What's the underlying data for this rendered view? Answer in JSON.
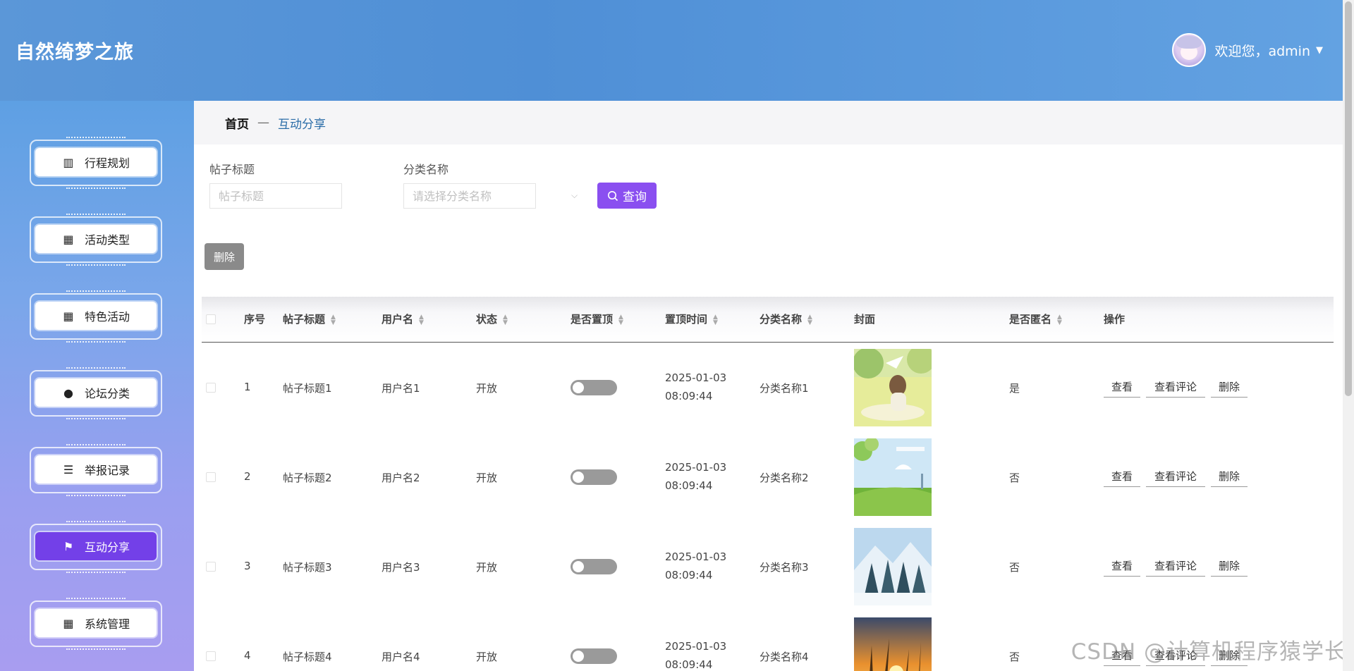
{
  "header": {
    "app_title": "自然绮梦之旅",
    "welcome_text": "欢迎您，admin",
    "caret": "▼"
  },
  "sidebar": {
    "items": [
      {
        "label": "行程规划",
        "icon": "bookshelf-icon",
        "glyph": "▥",
        "active": false
      },
      {
        "label": "活动类型",
        "icon": "grid-icon",
        "glyph": "▦",
        "active": false
      },
      {
        "label": "特色活动",
        "icon": "grid-icon",
        "glyph": "▦",
        "active": false
      },
      {
        "label": "论坛分类",
        "icon": "bulb-icon",
        "glyph": "●",
        "active": false
      },
      {
        "label": "举报记录",
        "icon": "sliders-icon",
        "glyph": "☰",
        "active": false
      },
      {
        "label": "互动分享",
        "icon": "flag-icon",
        "glyph": "⚑",
        "active": true
      },
      {
        "label": "系统管理",
        "icon": "grid-icon",
        "glyph": "▦",
        "active": false
      }
    ]
  },
  "breadcrumb": {
    "home": "首页",
    "separator": "—",
    "current": "互动分享"
  },
  "search": {
    "title_label": "帖子标题",
    "title_placeholder": "帖子标题",
    "category_label": "分类名称",
    "category_placeholder": "请选择分类名称",
    "search_button": "查询"
  },
  "toolbar": {
    "delete_label": "删除"
  },
  "table": {
    "columns": [
      "序号",
      "帖子标题",
      "用户名",
      "状态",
      "是否置顶",
      "置顶时间",
      "分类名称",
      "封面",
      "是否匿名",
      "操作"
    ],
    "rows": [
      {
        "index": "1",
        "title": "帖子标题1",
        "username": "用户名1",
        "status": "开放",
        "pinned": false,
        "pin_time": "2025-01-03 08:09:44",
        "category": "分类名称1",
        "cover": "girl-meadow",
        "anonymous": "是"
      },
      {
        "index": "2",
        "title": "帖子标题2",
        "username": "用户名2",
        "status": "开放",
        "pinned": false,
        "pin_time": "2025-01-03 08:09:44",
        "category": "分类名称2",
        "cover": "green-field",
        "anonymous": "否"
      },
      {
        "index": "3",
        "title": "帖子标题3",
        "username": "用户名3",
        "status": "开放",
        "pinned": false,
        "pin_time": "2025-01-03 08:09:44",
        "category": "分类名称3",
        "cover": "snow-forest",
        "anonymous": "否"
      },
      {
        "index": "4",
        "title": "帖子标题4",
        "username": "用户名4",
        "status": "开放",
        "pinned": false,
        "pin_time": "2025-01-03 08:09:44",
        "category": "分类名称4",
        "cover": "sunset-grass",
        "anonymous": "否"
      }
    ],
    "actions": {
      "view": "查看",
      "view_comments": "查看评论",
      "delete": "删除"
    }
  },
  "watermark": "CSDN @计算机程序猿学长",
  "colors": {
    "accent": "#7340e8",
    "search_button": "#8a4ff0",
    "breadcrumb_current": "#2b6da8"
  }
}
